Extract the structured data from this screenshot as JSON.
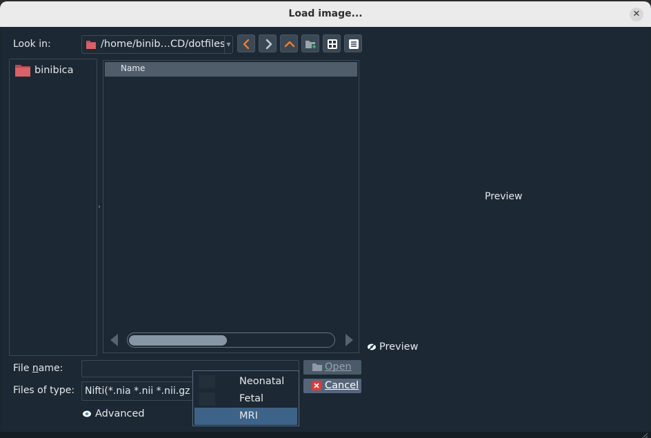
{
  "dialog": {
    "title": "Load image..."
  },
  "look_in": {
    "label": "Look in:",
    "path": "/home/binib…CD/dotfiles"
  },
  "toolbar": {
    "icons": [
      "back-arrow-icon",
      "forward-arrow-icon",
      "parent-folder-icon",
      "new-folder-icon",
      "list-view-icon",
      "detail-view-icon"
    ]
  },
  "places": {
    "items": [
      {
        "label": "binibica",
        "icon": "folder-icon"
      }
    ]
  },
  "file_list": {
    "column_name": "Name",
    "scroll_position": 0.0
  },
  "preview": {
    "area_label": "Preview",
    "checkbox_label": "Preview"
  },
  "file_name": {
    "label": "File name:",
    "value": ""
  },
  "files_of_type": {
    "label": "Files of type:",
    "value": "Nifti(*.nia *.nii *.nii.gz *"
  },
  "buttons": {
    "open": "Open",
    "cancel": "Cancel"
  },
  "advanced": {
    "label": "Advanced"
  },
  "dropdown": {
    "options": [
      "Neonatal",
      "Fetal",
      "MRI"
    ],
    "selected": "MRI"
  },
  "colors": {
    "background": "#1c2833",
    "titlebar": "#ebebeb",
    "accent_orange": "#f07f2c",
    "selection": "#3e6389",
    "folder_red": "#c65258"
  }
}
